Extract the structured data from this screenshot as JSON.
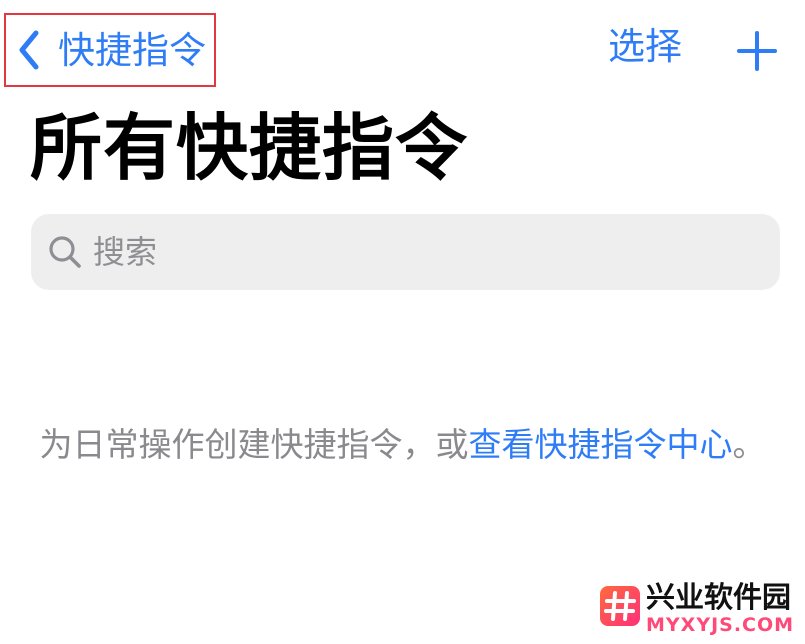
{
  "nav": {
    "back_label": "快捷指令",
    "select_label": "选择",
    "back_icon": "chevron-left-icon",
    "add_icon": "plus-icon"
  },
  "header": {
    "title": "所有快捷指令"
  },
  "search": {
    "placeholder": "搜索",
    "value": "",
    "icon": "magnifier-icon"
  },
  "empty_state": {
    "text": "为日常操作创建快捷指令，或",
    "link_text": "查看快捷指令中心",
    "suffix": "。"
  },
  "watermark": {
    "name": "兴业软件园",
    "domain": "MYXYJS.COM"
  },
  "colors": {
    "accent": "#2f7df6",
    "highlight_border": "#e2393f",
    "search_background": "#eeeeef",
    "secondary_text": "#8a8a8e",
    "watermark_pink": "#ff4a79"
  }
}
